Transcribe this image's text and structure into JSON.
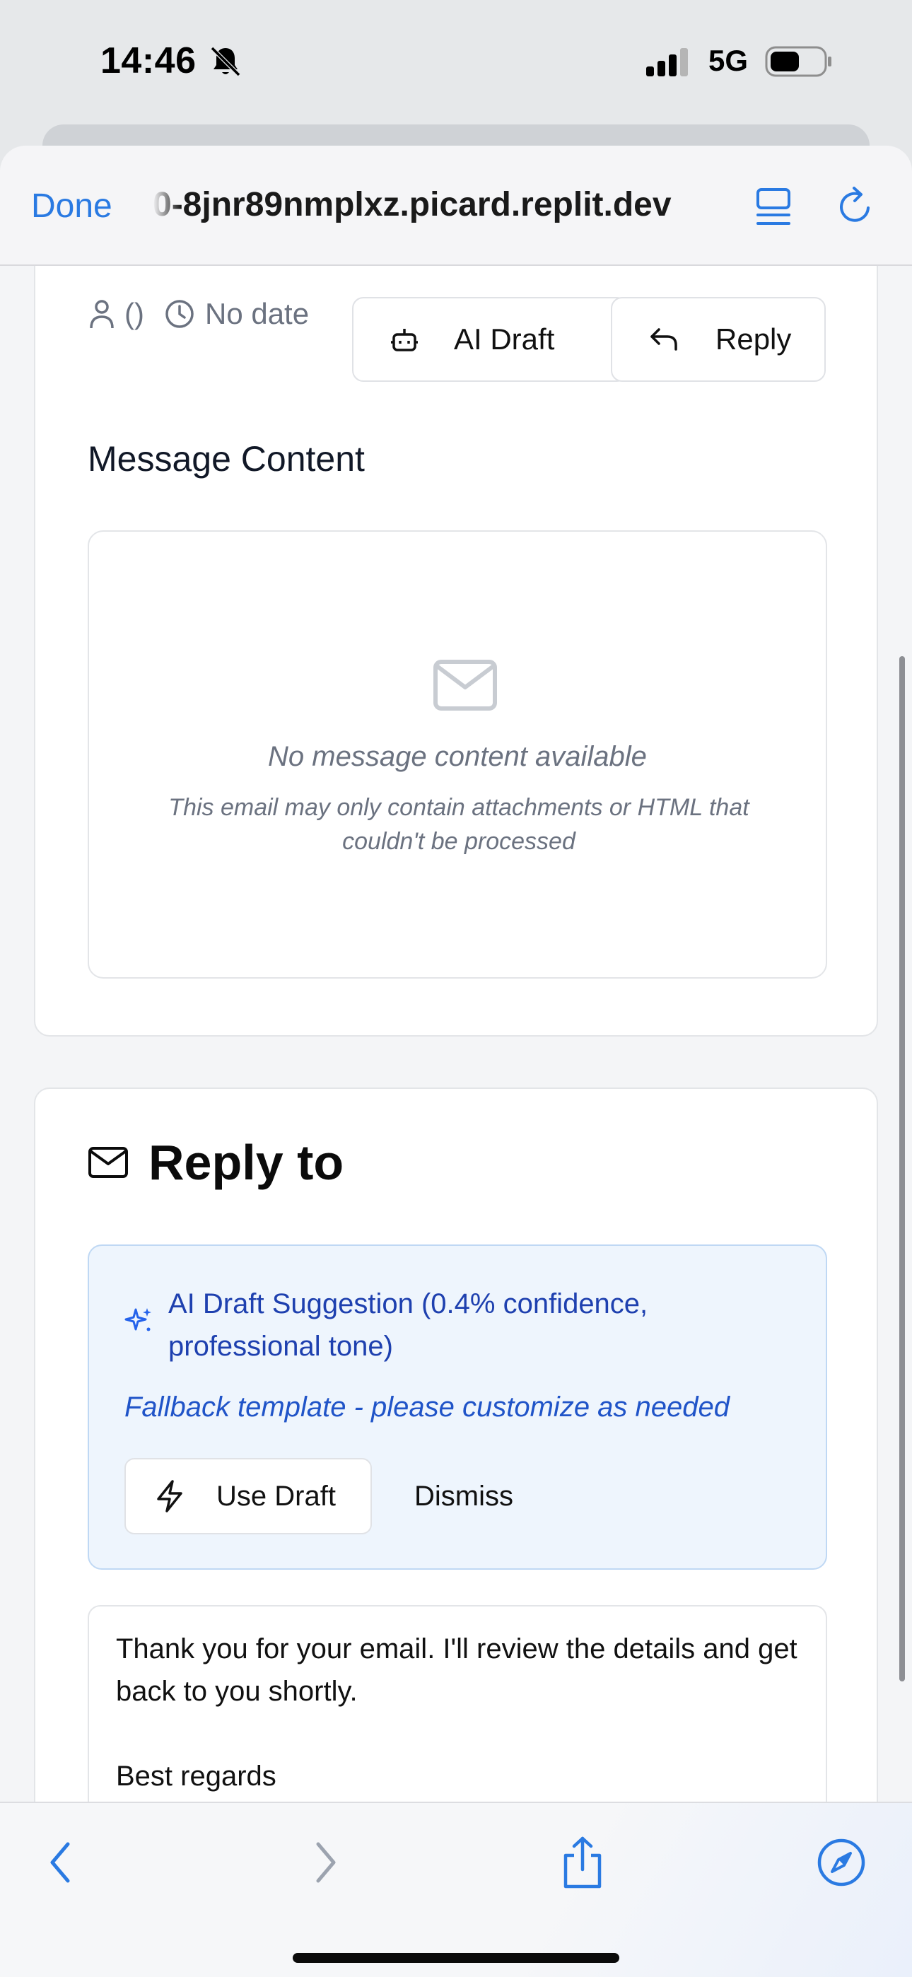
{
  "status_bar": {
    "time": "14:46",
    "network": "5G",
    "icons": [
      "bell-slash-icon",
      "signal-icon",
      "battery-icon"
    ]
  },
  "browser": {
    "done_label": "Done",
    "url": "0-8jnr89nmplxz.picard.replit.dev",
    "icons": [
      "reader-icon",
      "reload-icon"
    ],
    "toolbar_icons": [
      "back-icon",
      "forward-icon",
      "share-icon",
      "compass-icon"
    ]
  },
  "message": {
    "sender": "()",
    "date": "No date",
    "ai_draft_label": "AI Draft",
    "reply_label": "Reply",
    "content_title": "Message Content",
    "empty_title": "No message content available",
    "empty_subtitle": "This email may only contain attachments or HTML that couldn't be processed"
  },
  "reply": {
    "title": "Reply to",
    "draft_heading": "AI Draft Suggestion (0.4% confidence, professional tone)",
    "draft_note": "Fallback template - please customize as needed",
    "use_draft_label": "Use Draft",
    "dismiss_label": "Dismiss",
    "body": "Thank you for your email. I'll review the details and get back to you shortly.\n\nBest regards"
  },
  "colors": {
    "accent": "#2a7ae2",
    "draft_background": "#eef5fd",
    "draft_text": "#1e40af"
  }
}
